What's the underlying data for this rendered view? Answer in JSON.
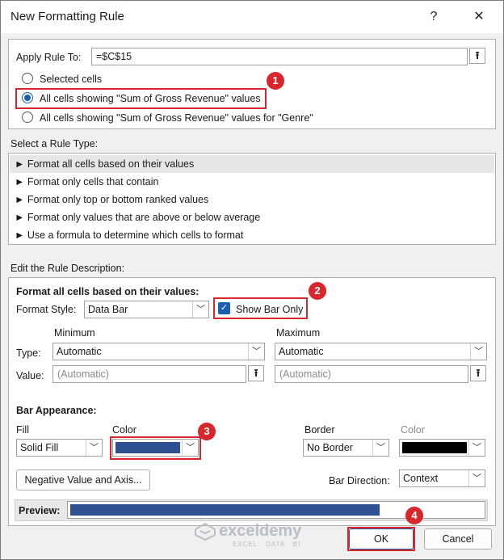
{
  "window": {
    "title": "New Formatting Rule",
    "help": "?",
    "close": "✕"
  },
  "apply_rule": {
    "label": "Apply Rule To:",
    "value": "=$C$15",
    "options": [
      "Selected cells",
      "All cells showing \"Sum of Gross Revenue\" values",
      "All cells showing \"Sum of Gross Revenue\" values for \"Genre\""
    ],
    "selected_index": 1
  },
  "rule_type": {
    "label": "Select a Rule Type:",
    "items": [
      "► Format all cells based on their values",
      "► Format only cells that contain",
      "► Format only top or bottom ranked values",
      "► Format only values that are above or below average",
      "► Use a formula to determine which cells to format"
    ],
    "selected_index": 0
  },
  "description": {
    "label": "Edit the Rule Description:",
    "heading": "Format all cells based on their values:",
    "format_style_label": "Format Style:",
    "format_style_value": "Data Bar",
    "show_bar_only_label": "Show Bar Only",
    "show_bar_only_checked": true,
    "minimum_label": "Minimum",
    "maximum_label": "Maximum",
    "type_label": "Type:",
    "value_label": "Value:",
    "min_type": "Automatic",
    "max_type": "Automatic",
    "min_value": "(Automatic)",
    "max_value": "(Automatic)"
  },
  "bar_appearance": {
    "heading": "Bar Appearance:",
    "fill_label": "Fill",
    "fill_value": "Solid Fill",
    "color_label": "Color",
    "fill_color": "#2f4f93",
    "border_label": "Border",
    "border_value": "No Border",
    "border_color_label": "Color",
    "border_color": "#000000",
    "negative_button": "Negative Value and Axis...",
    "bar_direction_label": "Bar Direction:",
    "bar_direction_value": "Context",
    "preview_label": "Preview:",
    "preview_fill_fraction": 0.75
  },
  "buttons": {
    "ok": "OK",
    "cancel": "Cancel"
  },
  "annotations": {
    "badge1": "1",
    "badge2": "2",
    "badge3": "3",
    "badge4": "4"
  },
  "watermark": {
    "brand": "exceldemy",
    "tagline": "EXCEL · DATA · BI"
  },
  "icons": {
    "collapse": "⭱",
    "dropdown": "﹀"
  }
}
